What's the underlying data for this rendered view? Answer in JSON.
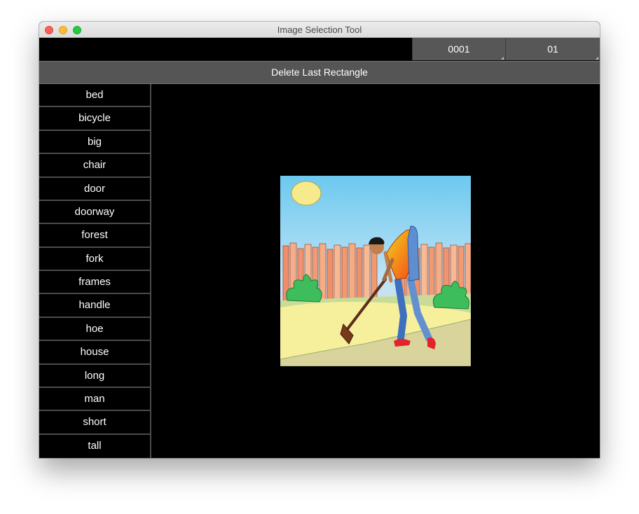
{
  "window": {
    "title": "Image Selection Tool"
  },
  "toolbar": {
    "image_number": "0001",
    "sub_number": "01",
    "delete_label": "Delete Last Rectangle"
  },
  "sidebar": {
    "items": [
      "bed",
      "bicycle",
      "big",
      "chair",
      "door",
      "doorway",
      "forest",
      "fork",
      "frames",
      "handle",
      "hoe",
      "house",
      "long",
      "man",
      "short",
      "tall"
    ]
  },
  "image": {
    "subject": "illustration of a man using a hoe in front of a wooden fence"
  },
  "colors": {
    "button_bg": "#555555",
    "sidebar_divider": "#4b4b4b",
    "background": "#000000"
  }
}
